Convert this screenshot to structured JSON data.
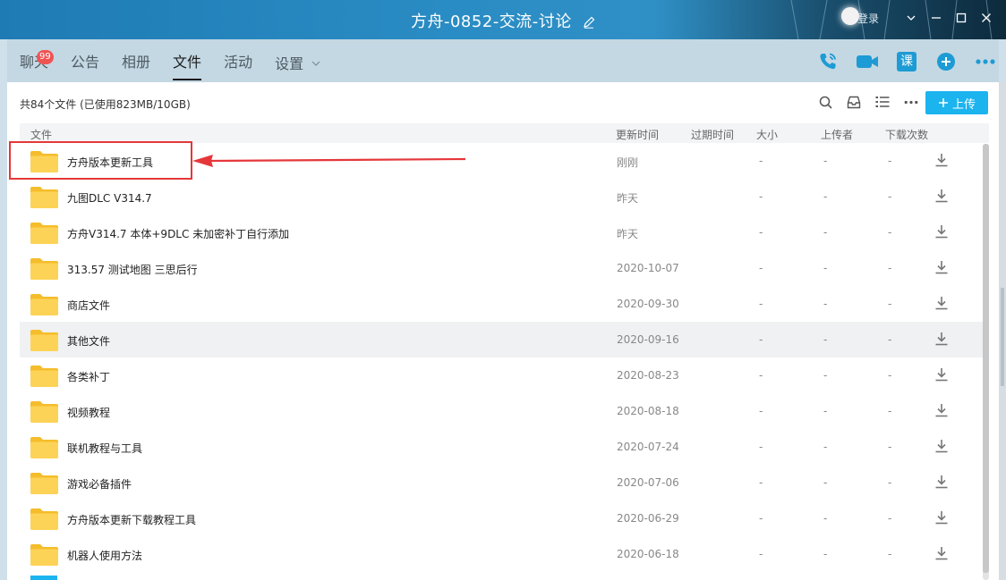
{
  "window": {
    "title": "方舟-0852-交流-讨论",
    "login_text": "登录",
    "colors": {
      "titlebar": "#2a8cc4",
      "accent": "#1bb4ef",
      "badge": "#f05353",
      "annotation": "#e5373a",
      "folder": "#fdd357"
    }
  },
  "tabs": [
    {
      "label": "聊天",
      "badge": "99"
    },
    {
      "label": "公告"
    },
    {
      "label": "相册"
    },
    {
      "label": "文件",
      "active": true
    },
    {
      "label": "活动"
    },
    {
      "label": "设置"
    }
  ],
  "header_icons": [
    "phone-icon",
    "video-icon",
    "course-icon",
    "add-icon",
    "more-icon"
  ],
  "course_label": "课",
  "files": {
    "summary": "共84个文件 (已使用823MB/10GB)",
    "upload_label": "上传",
    "columns": [
      "文件",
      "更新时间",
      "过期时间",
      "大小",
      "上传者",
      "下载次数"
    ],
    "rows": [
      {
        "name": "方舟版本更新工具",
        "updated": "刚刚",
        "expire": "-",
        "size": "-",
        "uploader": "-"
      },
      {
        "name": "九图DLC V314.7",
        "updated": "昨天",
        "expire": "-",
        "size": "-",
        "uploader": "-"
      },
      {
        "name": "方舟V314.7 本体+9DLC 未加密补丁自行添加",
        "updated": "昨天",
        "expire": "-",
        "size": "-",
        "uploader": "-"
      },
      {
        "name": "313.57 测试地图 三思后行",
        "updated": "2020-10-07",
        "expire": "-",
        "size": "-",
        "uploader": "-"
      },
      {
        "name": "商店文件",
        "updated": "2020-09-30",
        "expire": "-",
        "size": "-",
        "uploader": "-"
      },
      {
        "name": "其他文件",
        "updated": "2020-09-16",
        "expire": "-",
        "size": "-",
        "uploader": "-"
      },
      {
        "name": "各类补丁",
        "updated": "2020-08-23",
        "expire": "-",
        "size": "-",
        "uploader": "-"
      },
      {
        "name": "视频教程",
        "updated": "2020-08-18",
        "expire": "-",
        "size": "-",
        "uploader": "-"
      },
      {
        "name": "联机教程与工具",
        "updated": "2020-07-24",
        "expire": "-",
        "size": "-",
        "uploader": "-"
      },
      {
        "name": "游戏必备插件",
        "updated": "2020-07-06",
        "expire": "-",
        "size": "-",
        "uploader": "-"
      },
      {
        "name": "方舟版本更新下载教程工具",
        "updated": "2020-06-29",
        "expire": "-",
        "size": "-",
        "uploader": "-"
      },
      {
        "name": "机器人使用方法",
        "updated": "2020-06-18",
        "expire": "-",
        "size": "-",
        "uploader": "-"
      }
    ]
  }
}
